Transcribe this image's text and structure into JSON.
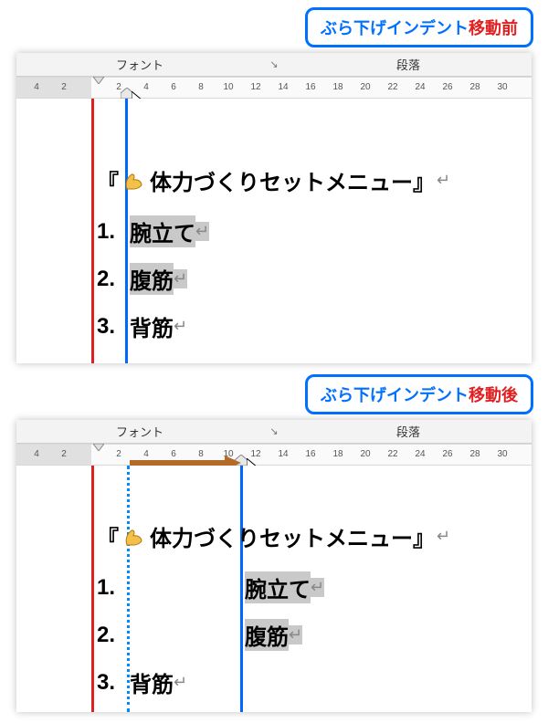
{
  "callouts": {
    "before": {
      "blue": "ぶら下げインデント",
      "red": "移動前"
    },
    "after": {
      "blue": "ぶら下げインデント",
      "red": "移動後"
    }
  },
  "ribbon": {
    "font": "フォント",
    "paragraph": "段落",
    "dialog": "↘"
  },
  "ruler_labels": [
    "4",
    "2",
    "2",
    "4",
    "6",
    "8",
    "10",
    "12",
    "14",
    "16",
    "18",
    "20",
    "22",
    "24",
    "26",
    "28",
    "30"
  ],
  "content": {
    "title_open": "『",
    "title_text": "体力づくりセットメニュー』",
    "pilcrow": "↵",
    "items": [
      {
        "num": "1.",
        "text": "腕立て"
      },
      {
        "num": "2.",
        "text": "腹筋"
      },
      {
        "num": "3.",
        "text": "背筋"
      }
    ]
  },
  "icons": {
    "muscle": "muscle-icon",
    "mouse": "mouse-icon",
    "cursor": "cursor-icon",
    "arrow": "right-arrow-icon"
  }
}
